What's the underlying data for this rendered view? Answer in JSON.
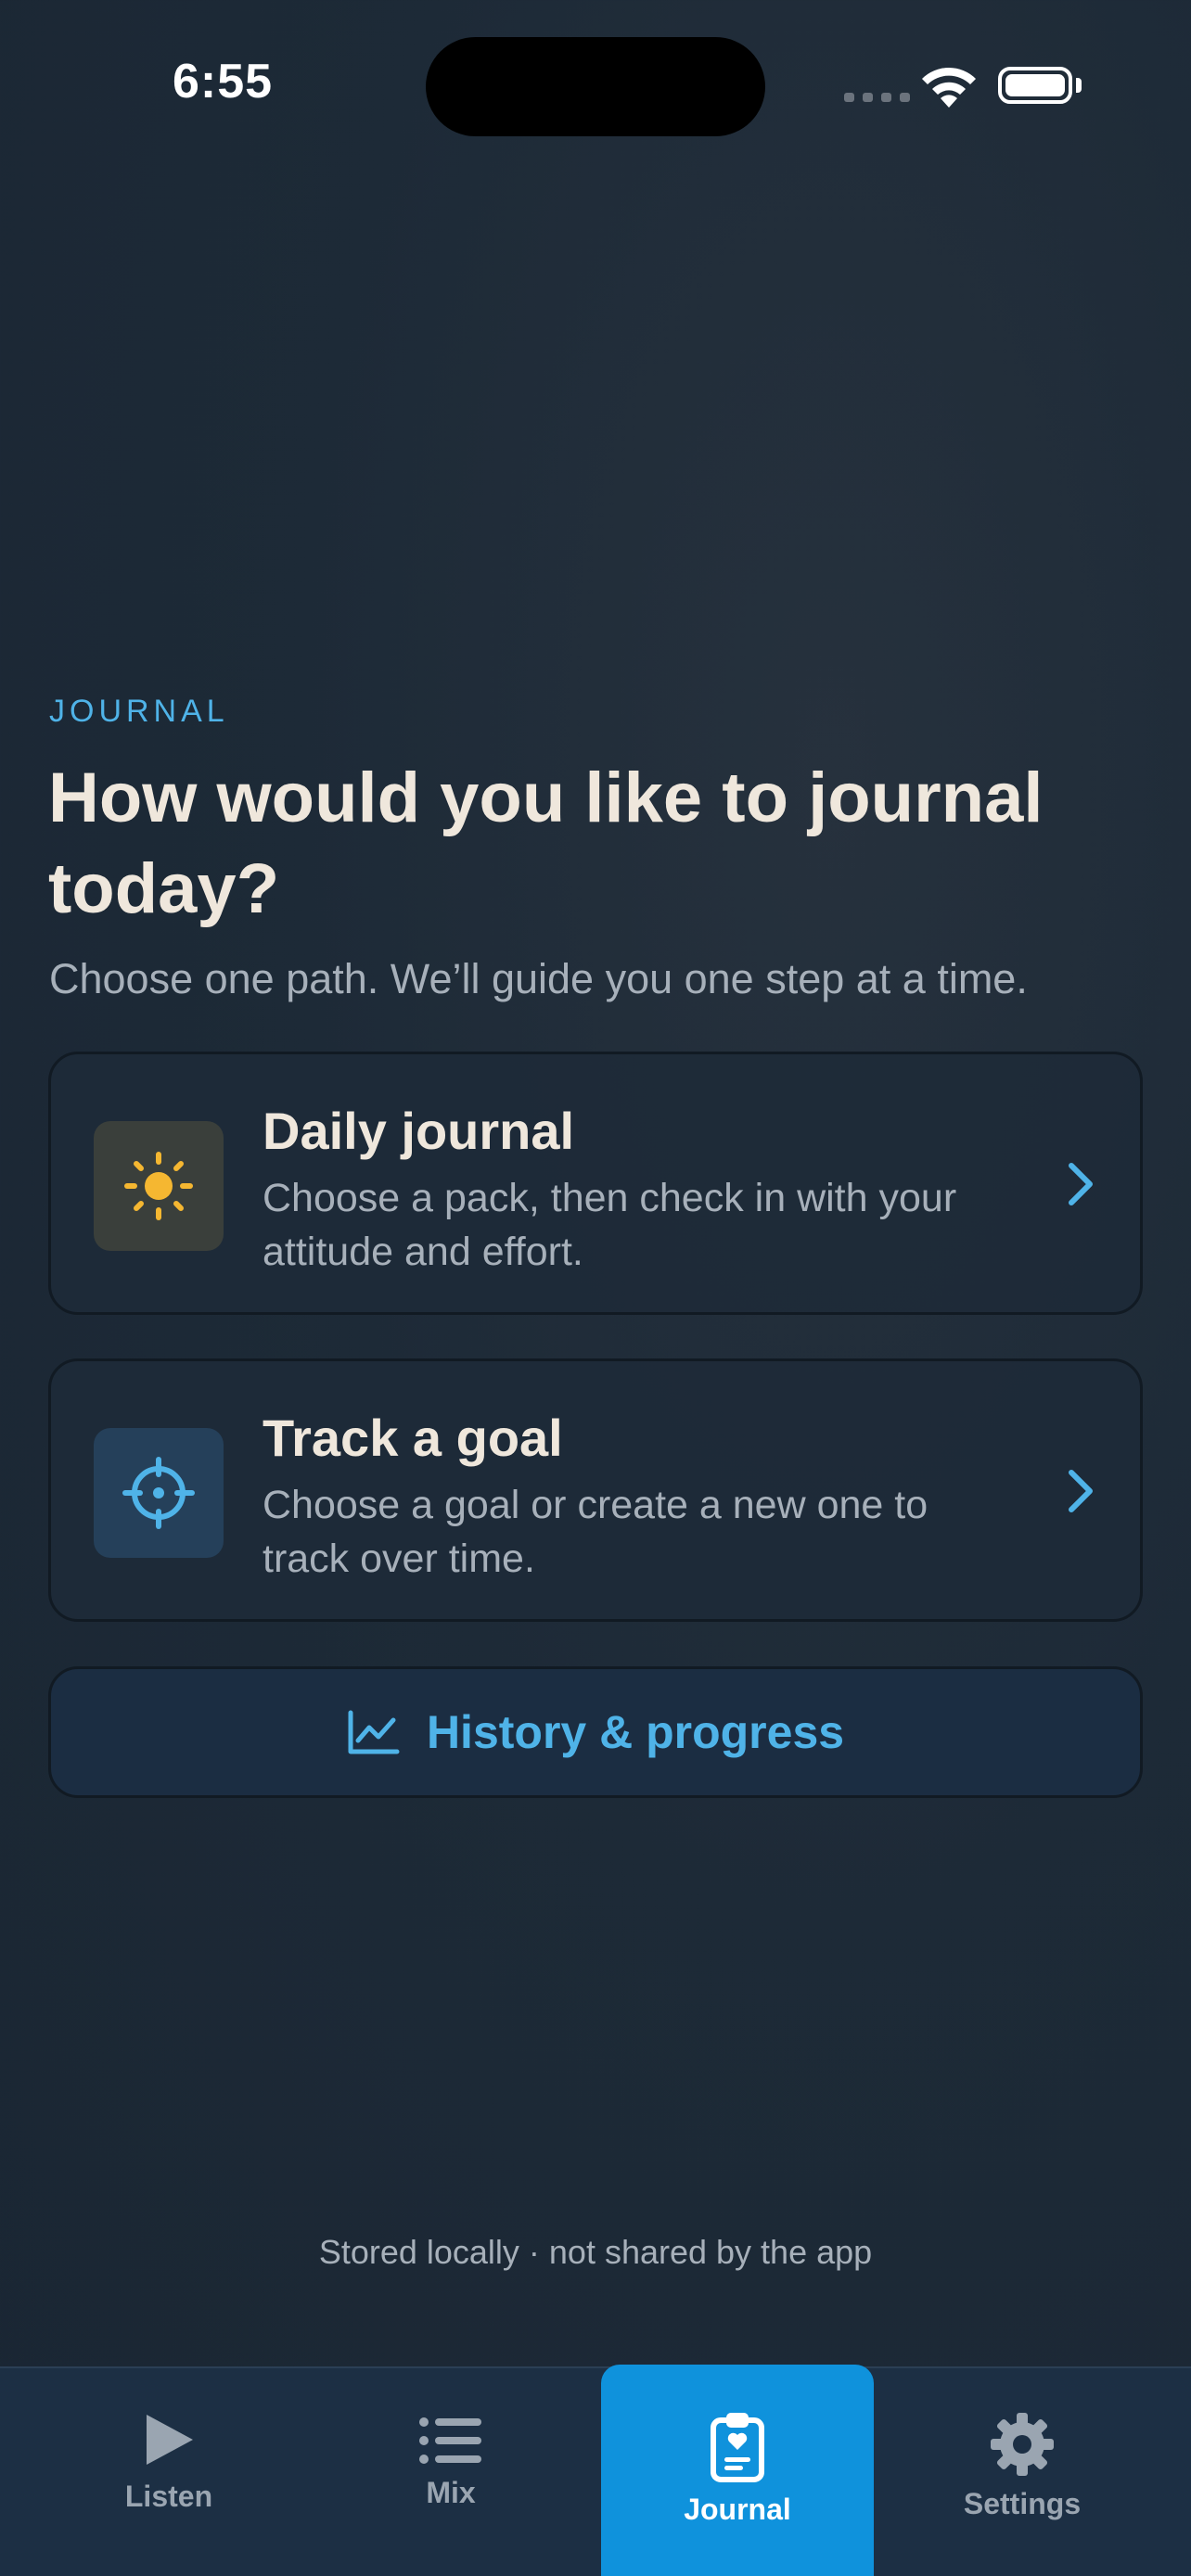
{
  "status_bar": {
    "time": "6:55"
  },
  "header": {
    "eyebrow": "JOURNAL",
    "title": "How would you like to journal today?",
    "subtitle": "Choose one path. We’ll guide you one step at a time."
  },
  "options": [
    {
      "icon": "sun-icon",
      "title": "Daily journal",
      "description": "Choose a pack, then check in with your attitude and effort."
    },
    {
      "icon": "crosshair-icon",
      "title": "Track a goal",
      "description": "Choose a goal or create a new one to track over time."
    }
  ],
  "history": {
    "icon": "line-chart-icon",
    "label": "History & progress"
  },
  "footnote": "Stored locally · not shared by the app",
  "tabs": [
    {
      "label": "Listen",
      "icon": "play-icon"
    },
    {
      "label": "Mix",
      "icon": "list-icon"
    },
    {
      "label": "Journal",
      "icon": "clipboard-heart-icon",
      "active": true
    },
    {
      "label": "Settings",
      "icon": "gear-icon"
    }
  ],
  "colors": {
    "accent": "#4fb3e8",
    "active_tab": "#0f92dc",
    "sun": "#f5b731",
    "text_primary": "#efe7dc",
    "text_secondary": "#a7b0ba"
  }
}
